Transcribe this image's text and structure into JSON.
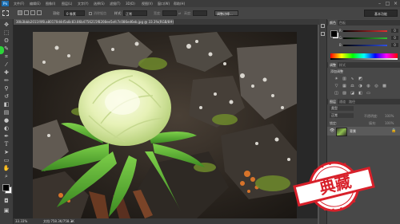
{
  "menubar": {
    "logo": "Ps",
    "items": [
      "文件(F)",
      "编辑(E)",
      "图像(I)",
      "图层(L)",
      "文字(Y)",
      "选择(S)",
      "滤镜(T)",
      "3D(D)",
      "视图(V)",
      "窗口(W)",
      "帮助(H)"
    ]
  },
  "options": {
    "feather_label": "羽化:",
    "feather_value": "0 像素",
    "antialias_label": "消除锯齿",
    "style_label": "样式:",
    "style_value": "正常",
    "width_label": "宽度:",
    "height_label": "高度:",
    "refine_edge": "调整边缘...",
    "workspace": "基本功能"
  },
  "document": {
    "tab_title": "30b3bbb2011f4f8.a80170d4d5a8c83.86b4756215f8208ee5efc7c086ed6eb.jpg @ 33.3%(RGB/8#) ×",
    "status_zoom": "33.33%",
    "status_doc": "文档:758.3K/758.3K"
  },
  "color_panel": {
    "tabs": [
      "颜色",
      "色板"
    ],
    "channels": [
      {
        "label": "R",
        "value": "0",
        "color": "#e03030"
      },
      {
        "label": "G",
        "value": "0",
        "color": "#30c030"
      },
      {
        "label": "B",
        "value": "0",
        "color": "#3050e0"
      }
    ]
  },
  "adjust_panel": {
    "tabs": [
      "调整",
      "样式"
    ],
    "title": "添加调整"
  },
  "layers_panel": {
    "tabs": [
      "图层",
      "通道",
      "路径"
    ],
    "kind_label": "类型",
    "blend_mode": "正常",
    "opacity_label": "不透明度:",
    "opacity_value": "100%",
    "lock_label": "锁定:",
    "fill_label": "填充:",
    "fill_value": "100%",
    "layer_name": "背景"
  },
  "watermark": {
    "text": "典藏"
  },
  "colors": {
    "accent": "#1f6fb0",
    "stamp_red": "#d8202a"
  }
}
